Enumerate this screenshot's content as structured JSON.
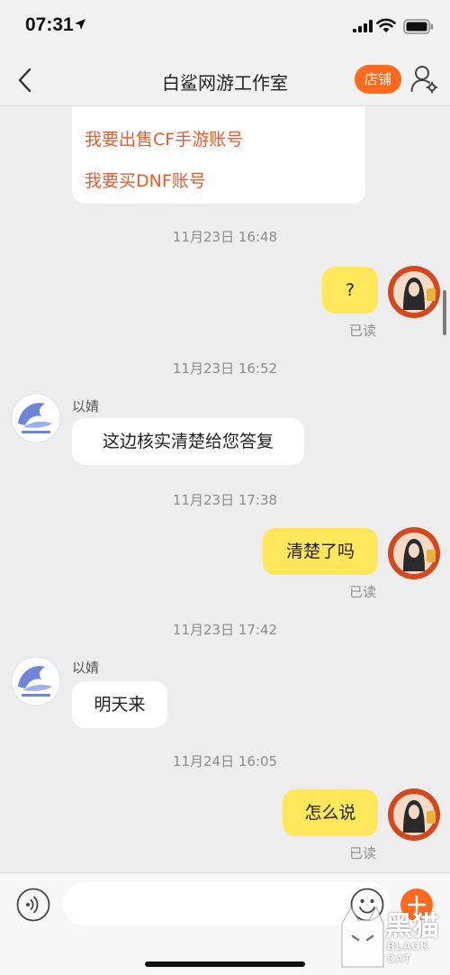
{
  "status_bar": {
    "time": "07:31",
    "icons": [
      "location-arrow-icon",
      "signal-icon",
      "wifi-icon",
      "battery-icon"
    ]
  },
  "nav": {
    "title": "白鲨网游工作室",
    "shop_label": "店铺",
    "icons": [
      "back-chevron-icon",
      "profile-settings-icon"
    ]
  },
  "menu_card": {
    "link1": "我要出售CF手游账号",
    "link2": "我要买DNF账号"
  },
  "messages": [
    {
      "time": "11月23日 16:48",
      "direction": "out",
      "text": "?",
      "status": "已读"
    },
    {
      "time": "11月23日 16:52",
      "direction": "in",
      "sender": "以婧",
      "text": "这边核实清楚给您答复"
    },
    {
      "time": "11月23日 17:38",
      "direction": "out",
      "text": "清楚了吗",
      "status": "已读"
    },
    {
      "time": "11月23日 17:42",
      "direction": "in",
      "sender": "以婧",
      "text": "明天来"
    },
    {
      "time": "11月24日 16:05",
      "direction": "out",
      "text": "怎么说",
      "status": "已读"
    }
  ],
  "input_bar": {
    "placeholder": "",
    "icons": [
      "voice-icon",
      "emoji-icon",
      "plus-icon"
    ]
  },
  "watermark": {
    "brand_cn": "黑猫",
    "brand_en": "BLACK CAT"
  },
  "colors": {
    "accent_orange": "#ff6a1f",
    "link_orange": "#ee5a2a",
    "outgoing_bubble": "#ffe75c",
    "incoming_bubble": "#ffffff",
    "chat_background": "#ededed"
  }
}
